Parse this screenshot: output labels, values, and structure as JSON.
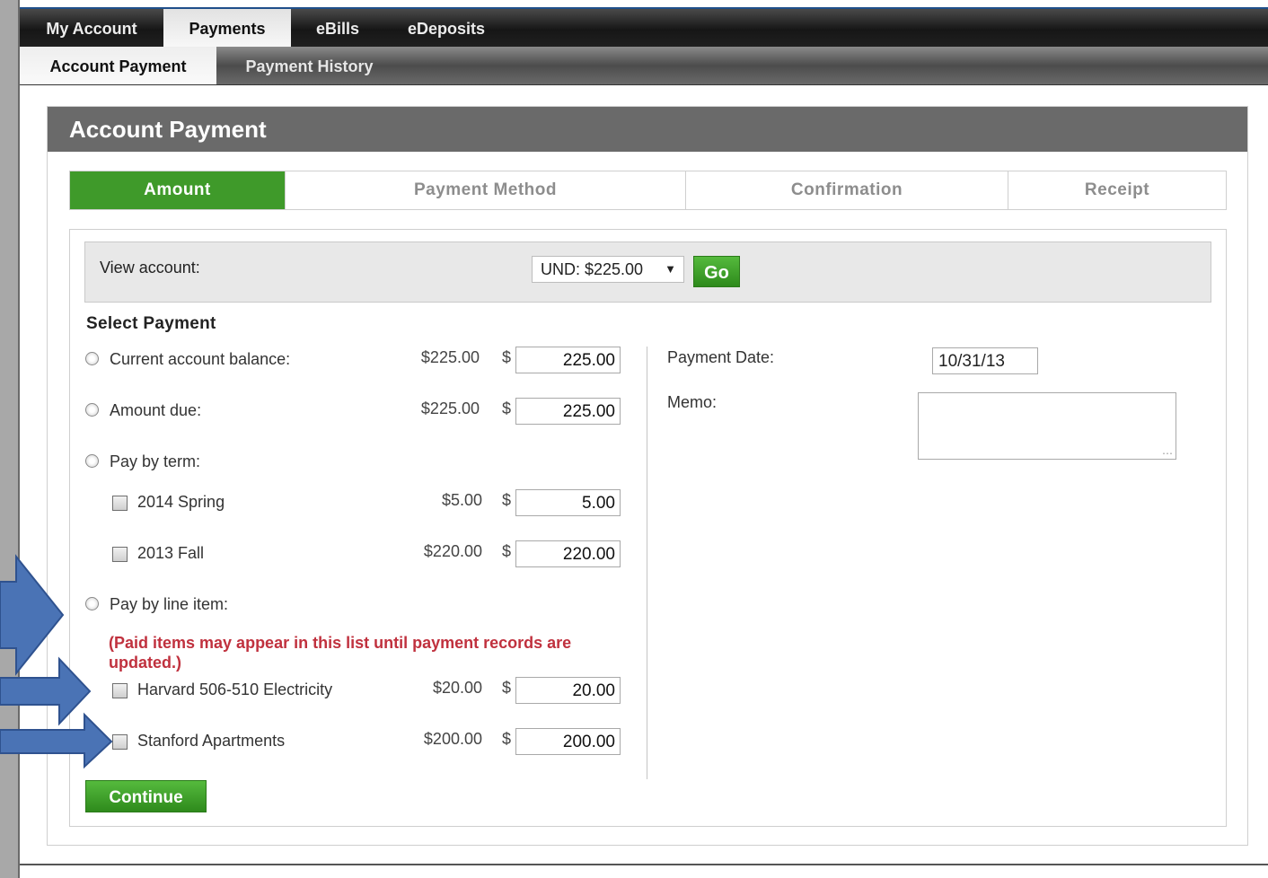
{
  "nav": {
    "tabs": [
      {
        "label": "My Account"
      },
      {
        "label": "Payments"
      },
      {
        "label": "eBills"
      },
      {
        "label": "eDeposits"
      }
    ],
    "subtabs": [
      {
        "label": "Account Payment"
      },
      {
        "label": "Payment History"
      }
    ]
  },
  "panel": {
    "title": "Account Payment"
  },
  "steps": [
    {
      "label": "Amount"
    },
    {
      "label": "Payment Method"
    },
    {
      "label": "Confirmation"
    },
    {
      "label": "Receipt"
    }
  ],
  "view_account": {
    "label": "View account:",
    "selected": "UND: $225.00",
    "go_label": "Go"
  },
  "select_payment": {
    "title": "Select Payment",
    "current_balance": {
      "label": "Current account balance:",
      "amount": "$225.00",
      "currency": "$",
      "value": "225.00"
    },
    "amount_due": {
      "label": "Amount due:",
      "amount": "$225.00",
      "currency": "$",
      "value": "225.00"
    },
    "pay_by_term": {
      "label": "Pay by term:",
      "items": [
        {
          "label": "2014 Spring",
          "amount": "$5.00",
          "currency": "$",
          "value": "5.00"
        },
        {
          "label": "2013 Fall",
          "amount": "$220.00",
          "currency": "$",
          "value": "220.00"
        }
      ]
    },
    "pay_by_line_item": {
      "label": "Pay by line item:",
      "note": "(Paid items may appear in this list until payment records are updated.)",
      "items": [
        {
          "label": "Harvard 506-510 Electricity",
          "amount": "$20.00",
          "currency": "$",
          "value": "20.00"
        },
        {
          "label": "Stanford Apartments",
          "amount": "$200.00",
          "currency": "$",
          "value": "200.00"
        }
      ]
    }
  },
  "right": {
    "payment_date_label": "Payment Date:",
    "payment_date_value": "10/31/13",
    "memo_label": "Memo:"
  },
  "continue_label": "Continue",
  "colors": {
    "accent_green": "#3f9a2a",
    "note_red": "#c0313e",
    "arrow_blue": "#4a73b5"
  }
}
